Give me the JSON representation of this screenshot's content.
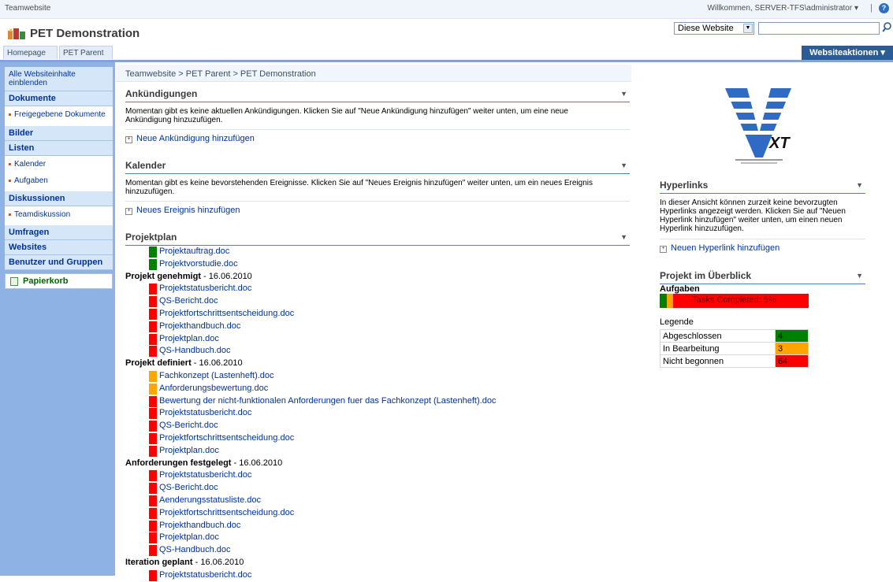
{
  "topbar": {
    "site_name": "Teamwebsite",
    "welcome": "Willkommen, SERVER-TFS\\administrator ▾",
    "separator": "|",
    "help_icon": "?"
  },
  "header": {
    "title": "PET Demonstration",
    "scope_value": "Diese Website",
    "search_value": ""
  },
  "nav": {
    "tabs": [
      "Homepage",
      "PET Parent"
    ],
    "site_actions": "Websiteaktionen ▾"
  },
  "quicklaunch": {
    "all_content": "Alle Websiteinhalte einblenden",
    "documents": "Dokumente",
    "shared_docs": "Freigegebene Dokumente",
    "pictures": "Bilder",
    "lists": "Listen",
    "calendar": "Kalender",
    "tasks": "Aufgaben",
    "discussions": "Diskussionen",
    "team_discussion": "Teamdiskussion",
    "surveys": "Umfragen",
    "sites": "Websites",
    "people": "Benutzer und Gruppen",
    "recycle_bin": "Papierkorb"
  },
  "breadcrumb": "Teamwebsite > PET Parent > PET Demonstration",
  "announcements": {
    "title": "Ankündigungen",
    "text": "Momentan gibt es keine aktuellen Ankündigungen. Klicken Sie auf \"Neue Ankündigung hinzufügen\" weiter unten, um eine neue Ankündigung hinzuzufügen.",
    "add": "Neue Ankündigung hinzufügen"
  },
  "calendar": {
    "title": "Kalender",
    "text": "Momentan gibt es keine bevorstehenden Ereignisse. Klicken Sie auf \"Neues Ereignis hinzufügen\" weiter unten, um ein neues Ereignis hinzuzufügen.",
    "add": "Neues Ereignis hinzufügen"
  },
  "projectplan": {
    "title": "Projektplan",
    "rows": [
      {
        "type": "doc",
        "status": "green",
        "label": "Projektauftrag.doc"
      },
      {
        "type": "doc",
        "status": "green",
        "label": "Projektvorstudie.doc"
      },
      {
        "type": "group",
        "name": "Projekt genehmigt",
        "date": " - 16.06.2010"
      },
      {
        "type": "doc",
        "status": "red",
        "label": "Projektstatusbericht.doc"
      },
      {
        "type": "doc",
        "status": "red",
        "label": "QS-Bericht.doc"
      },
      {
        "type": "doc",
        "status": "red",
        "label": "Projektfortschrittsentscheidung.doc"
      },
      {
        "type": "doc",
        "status": "red",
        "label": "Projekthandbuch.doc"
      },
      {
        "type": "doc",
        "status": "red",
        "label": "Projektplan.doc"
      },
      {
        "type": "doc",
        "status": "red",
        "label": "QS-Handbuch.doc"
      },
      {
        "type": "group",
        "name": "Projekt definiert",
        "date": " - 16.06.2010"
      },
      {
        "type": "doc",
        "status": "orange",
        "label": "Fachkonzept (Lastenheft).doc"
      },
      {
        "type": "doc",
        "status": "orange",
        "label": "Anforderungsbewertung.doc"
      },
      {
        "type": "doc",
        "status": "red",
        "label": "Bewertung der nicht-funktionalen Anforderungen fuer das Fachkonzept (Lastenheft).doc"
      },
      {
        "type": "doc",
        "status": "red",
        "label": "Projektstatusbericht.doc"
      },
      {
        "type": "doc",
        "status": "red",
        "label": "QS-Bericht.doc"
      },
      {
        "type": "doc",
        "status": "red",
        "label": "Projektfortschrittsentscheidung.doc"
      },
      {
        "type": "doc",
        "status": "red",
        "label": "Projektplan.doc"
      },
      {
        "type": "group",
        "name": "Anforderungen festgelegt",
        "date": " - 16.06.2010"
      },
      {
        "type": "doc",
        "status": "red",
        "label": "Projektstatusbericht.doc"
      },
      {
        "type": "doc",
        "status": "red",
        "label": "QS-Bericht.doc"
      },
      {
        "type": "doc",
        "status": "red",
        "label": "Aenderungsstatusliste.doc"
      },
      {
        "type": "doc",
        "status": "red",
        "label": "Projektfortschrittsentscheidung.doc"
      },
      {
        "type": "doc",
        "status": "red",
        "label": "Projekthandbuch.doc"
      },
      {
        "type": "doc",
        "status": "red",
        "label": "Projektplan.doc"
      },
      {
        "type": "doc",
        "status": "red",
        "label": "QS-Handbuch.doc"
      },
      {
        "type": "group",
        "name": "Iteration geplant",
        "date": " - 16.06.2010"
      },
      {
        "type": "doc",
        "status": "red",
        "label": "Projektstatusbericht.doc"
      }
    ]
  },
  "hyperlinks": {
    "title": "Hyperlinks",
    "text": "In dieser Ansicht können zurzeit keine bevorzugten Hyperlinks angezeigt werden. Klicken Sie auf \"Neuen Hyperlink hinzufügen\" weiter unten, um einen neuen Hyperlink hinzuzufügen.",
    "add": "Neuen Hyperlink hinzufügen"
  },
  "overview": {
    "title": "Projekt im Überblick",
    "tasks_heading": "Aufgaben",
    "progress_text": "Tasks Completed: 5%",
    "legend_heading": "Legende",
    "legend": [
      {
        "label": "Abgeschlossen",
        "value": "4",
        "color": "#008000"
      },
      {
        "label": "In Bearbeitung",
        "value": "3",
        "color": "#ffa500"
      },
      {
        "label": "Nicht begonnen",
        "value": "64",
        "color": "#ff0000"
      }
    ]
  },
  "colors": {
    "green": "#008000",
    "orange": "#ffa500",
    "red": "#ff0000",
    "site_actions_bg": "#2c5c95",
    "quicklaunch_bg": "#8db2e3"
  }
}
